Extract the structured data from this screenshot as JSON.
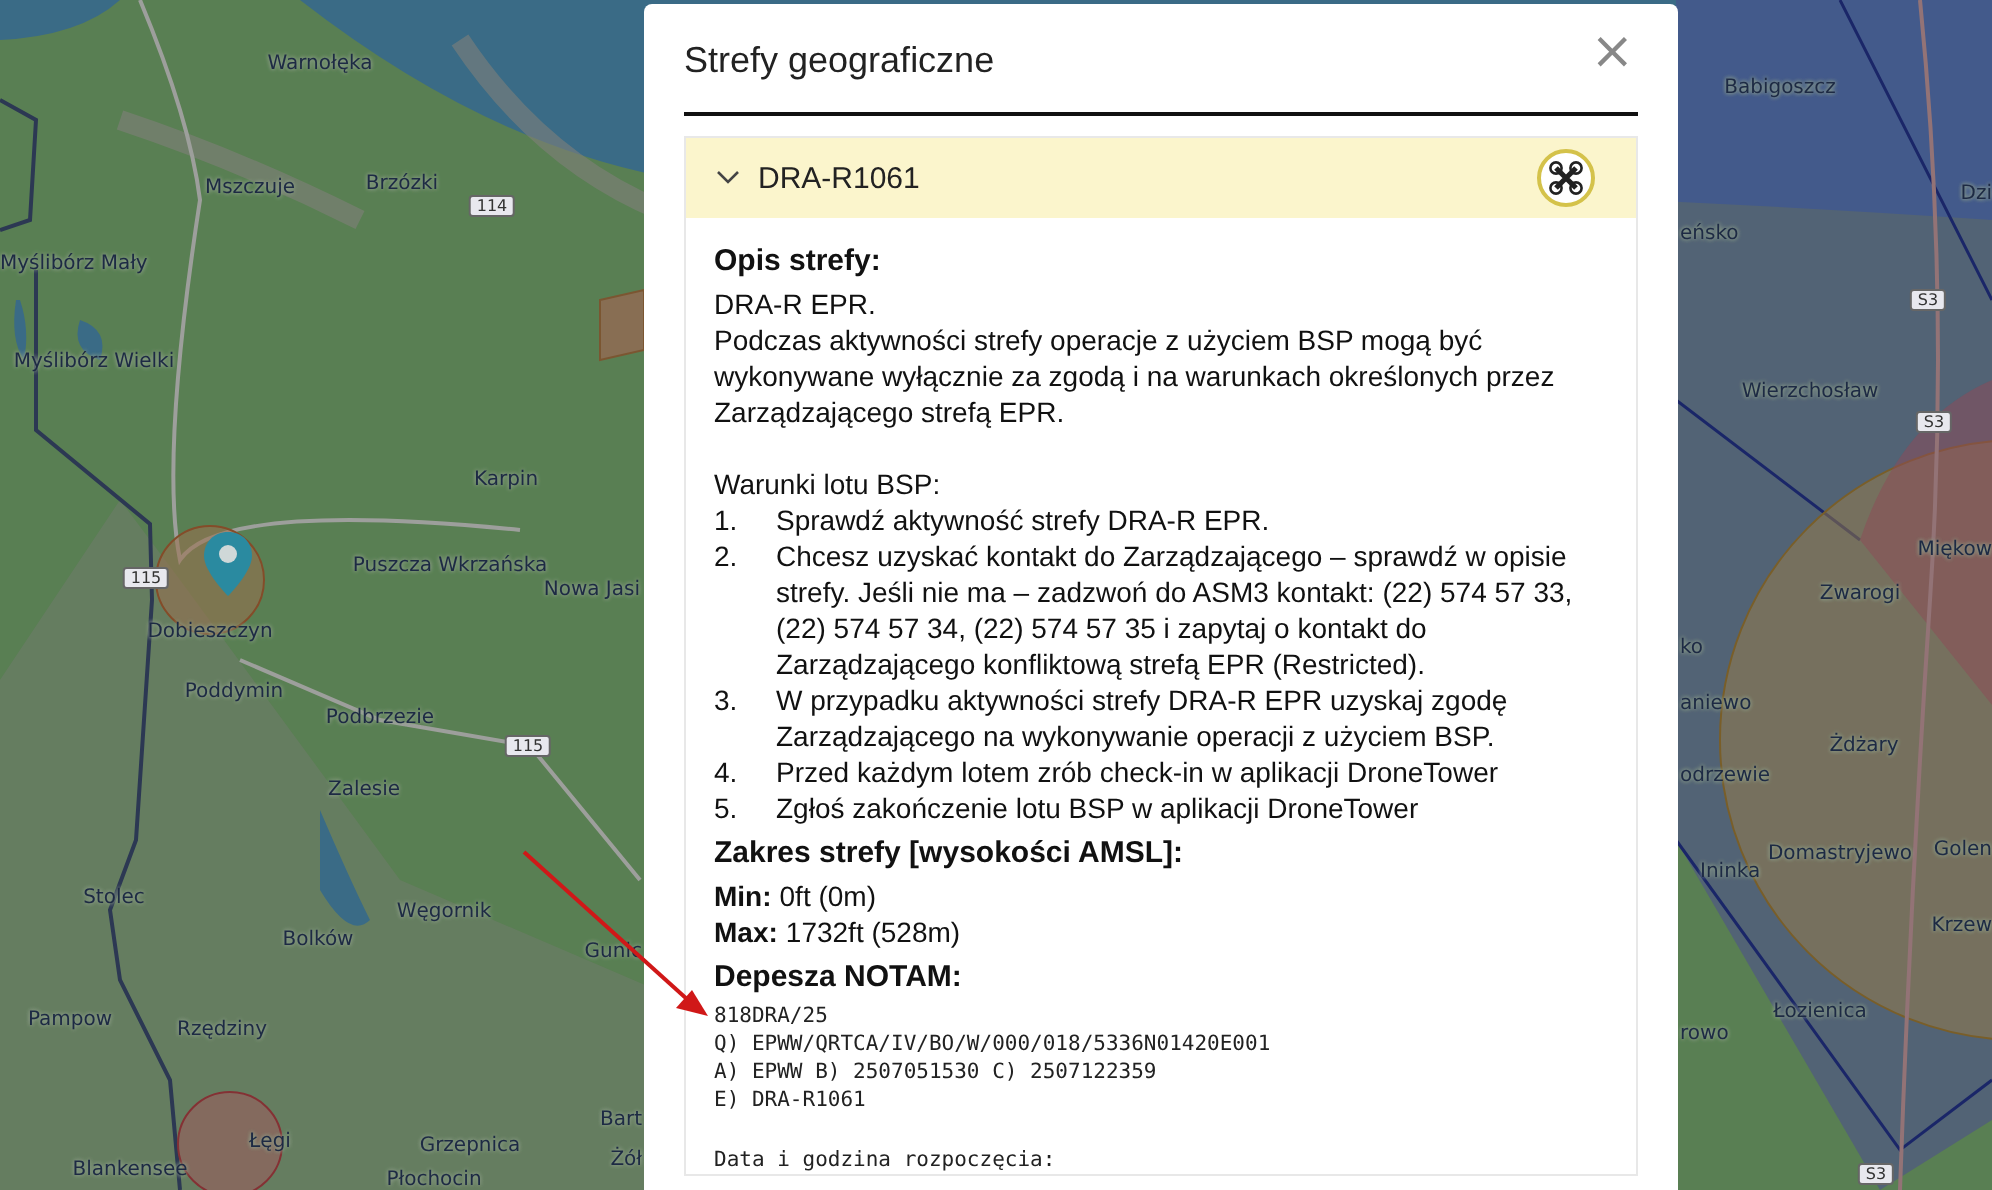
{
  "map": {
    "labels": [
      {
        "text": "Warnołęka"
      },
      {
        "text": "Mszczuje"
      },
      {
        "text": "Brzózki"
      },
      {
        "text": "Myślibórz Mały"
      },
      {
        "text": "Myślibórz Wielki"
      },
      {
        "text": "Karpin"
      },
      {
        "text": "Puszcza Wkrzańska"
      },
      {
        "text": "Nowa Jasi"
      },
      {
        "text": "Dobieszczyn"
      },
      {
        "text": "Poddymin"
      },
      {
        "text": "Podbrzezie"
      },
      {
        "text": "Zalesie"
      },
      {
        "text": "Stolec"
      },
      {
        "text": "Bolków"
      },
      {
        "text": "Węgornik"
      },
      {
        "text": "Gunic"
      },
      {
        "text": "Pampow"
      },
      {
        "text": "Rzędziny"
      },
      {
        "text": "Łęgi"
      },
      {
        "text": "Blankensee"
      },
      {
        "text": "Grzepnica"
      },
      {
        "text": "Płochocin"
      },
      {
        "text": "Bart"
      },
      {
        "text": "Żół"
      },
      {
        "text": "Babigoszcz"
      },
      {
        "text": "Dzi"
      },
      {
        "text": "eńsko"
      },
      {
        "text": "Wierzchosław"
      },
      {
        "text": "Miękow"
      },
      {
        "text": "Zwarogi"
      },
      {
        "text": "ko"
      },
      {
        "text": "aniewo"
      },
      {
        "text": "odrzewie"
      },
      {
        "text": "Żdżary"
      },
      {
        "text": "Ininka"
      },
      {
        "text": "Domastryjewo"
      },
      {
        "text": "Golen"
      },
      {
        "text": "Krzew"
      },
      {
        "text": "Łozienica"
      },
      {
        "text": "rowo"
      }
    ],
    "road_signs": [
      {
        "text": "114"
      },
      {
        "text": "115"
      },
      {
        "text": "115"
      },
      {
        "text": "S3"
      },
      {
        "text": "S3"
      },
      {
        "text": "S3"
      }
    ]
  },
  "dialog": {
    "title": "Strefy geograficzne",
    "close": "×",
    "zone": {
      "name": "DRA-R1061",
      "expanded": true,
      "description_heading": "Opis strefy:",
      "description": [
        "DRA-R EPR.",
        "Podczas aktywności strefy operacje z użyciem BSP mogą być wykonywane wyłącznie za zgodą i na warunkach określonych przez Zarządzającego strefą EPR."
      ],
      "conditions_heading": "Warunki lotu BSP:",
      "conditions": [
        {
          "number": "1.",
          "text": "Sprawdź aktywność strefy DRA-R EPR."
        },
        {
          "number": "2.",
          "text": "Chcesz uzyskać kontakt do Zarządzającego – sprawdź w opisie strefy. Jeśli nie ma – zadzwoń do ASM3 kontakt: (22) 574 57 33, (22) 574 57 34, (22) 574 57 35 i zapytaj o kontakt do Zarządzającego konfliktową strefą EPR (Restricted)."
        },
        {
          "number": "3.",
          "text": "W przypadku aktywności strefy DRA-R EPR uzyskaj zgodę Zarządzającego na wykonywanie operacji z użyciem BSP."
        },
        {
          "number": "4.",
          "text": "Przed każdym lotem zrób check-in w aplikacji DroneTower"
        },
        {
          "number": "5.",
          "text": "Zgłoś zakończenie lotu BSP w aplikacji DroneTower"
        }
      ],
      "range_heading": "Zakres strefy [wysokości AMSL]:",
      "range": [
        {
          "label": "Min:",
          "value": "0ft (0m)"
        },
        {
          "label": "Max:",
          "value": "1732ft (528m)"
        }
      ],
      "notam_heading": "Depesza NOTAM:",
      "notam": [
        "818DRA/25",
        "Q) EPWW/QRTCA/IV/BO/W/000/018/5336N01420E001",
        "A) EPWW B) 2507051530 C) 2507122359",
        "E) DRA-R1061"
      ],
      "start_label": "Data i godzina rozpoczęcia:"
    }
  }
}
